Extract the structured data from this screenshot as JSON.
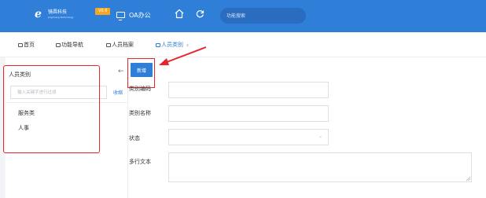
{
  "header": {
    "logo_text": "镜昌科技",
    "logo_sub": "Jingchang Technology",
    "version_badge": "V0.0",
    "oa_label": "OA办公",
    "search_placeholder": "功能搜索"
  },
  "tabs": [
    {
      "label": "首页",
      "active": false
    },
    {
      "label": "功能导航",
      "active": false
    },
    {
      "label": "人员档案",
      "active": false
    },
    {
      "label": "人员类别",
      "active": true,
      "close": "x"
    }
  ],
  "sidebar": {
    "title": "人员类别",
    "collapse_arrow": "←",
    "filter_placeholder": "输入关键字进行过滤",
    "collapse_label": "收缩",
    "items": [
      {
        "label": "服务类"
      },
      {
        "label": "人事"
      }
    ]
  },
  "toolbar": {
    "add_label": "新增"
  },
  "form": {
    "code_label": "类别编码",
    "name_label": "类别名称",
    "status_label": "状态",
    "multiline_label": "多行文本",
    "select_arrow": "⌄"
  },
  "colors": {
    "header_bg": "#2f7fd8",
    "accent": "#2f7fd8",
    "badge": "#f5a623",
    "annotation": "#e8252b"
  }
}
